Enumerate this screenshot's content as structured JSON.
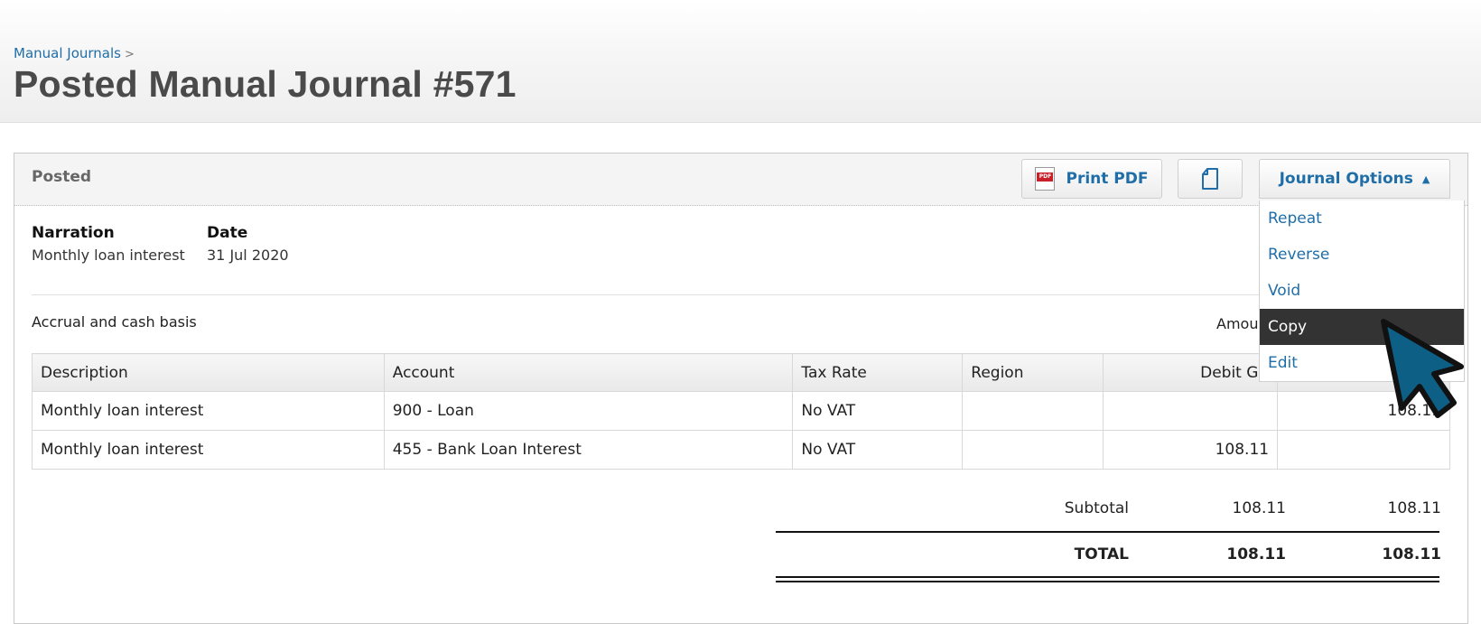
{
  "breadcrumb": {
    "parent": "Manual Journals",
    "separator": ">"
  },
  "page": {
    "title": "Posted Manual Journal #571"
  },
  "panel": {
    "status": "Posted",
    "print_label": "Print PDF",
    "options_label": "Journal Options"
  },
  "options_menu": {
    "items": [
      {
        "label": "Repeat"
      },
      {
        "label": "Reverse"
      },
      {
        "label": "Void"
      },
      {
        "label": "Copy",
        "active": true
      },
      {
        "label": "Edit"
      }
    ]
  },
  "journal": {
    "narration_label": "Narration",
    "narration": "Monthly loan interest",
    "date_label": "Date",
    "date": "31 Jul 2020",
    "basis": "Accrual and cash basis",
    "amounts_label": "Amou"
  },
  "table": {
    "headers": [
      "Description",
      "Account",
      "Tax Rate",
      "Region",
      "Debit GB",
      ""
    ],
    "rows": [
      {
        "description": "Monthly loan interest",
        "account": "900 - Loan",
        "tax_rate": "No VAT",
        "region": "",
        "debit": "",
        "credit": "108.11"
      },
      {
        "description": "Monthly loan interest",
        "account": "455 - Bank Loan Interest",
        "tax_rate": "No VAT",
        "region": "",
        "debit": "108.11",
        "credit": ""
      }
    ]
  },
  "totals": {
    "subtotal_label": "Subtotal",
    "subtotal_debit": "108.11",
    "subtotal_credit": "108.11",
    "total_label": "TOTAL",
    "total_debit": "108.11",
    "total_credit": "108.11"
  },
  "colors": {
    "link": "#1f6ea8",
    "menu_active_bg": "#333333",
    "cursor": "#0e5f86"
  }
}
